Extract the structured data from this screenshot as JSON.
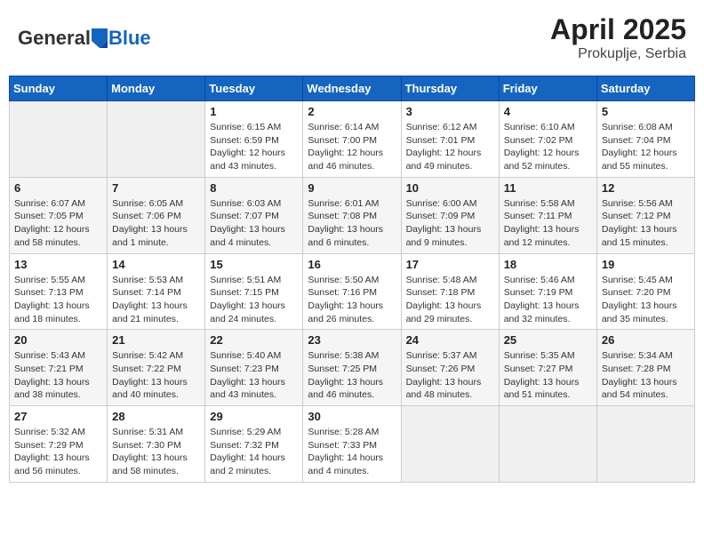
{
  "header": {
    "logo": {
      "general": "General",
      "blue": "Blue",
      "tagline": ""
    },
    "title": "April 2025",
    "subtitle": "Prokuplje, Serbia"
  },
  "weekdays": [
    "Sunday",
    "Monday",
    "Tuesday",
    "Wednesday",
    "Thursday",
    "Friday",
    "Saturday"
  ],
  "weeks": [
    [
      {
        "date": "",
        "empty": true
      },
      {
        "date": "",
        "empty": true
      },
      {
        "date": "1",
        "sunrise": "Sunrise: 6:15 AM",
        "sunset": "Sunset: 6:59 PM",
        "daylight": "Daylight: 12 hours and 43 minutes."
      },
      {
        "date": "2",
        "sunrise": "Sunrise: 6:14 AM",
        "sunset": "Sunset: 7:00 PM",
        "daylight": "Daylight: 12 hours and 46 minutes."
      },
      {
        "date": "3",
        "sunrise": "Sunrise: 6:12 AM",
        "sunset": "Sunset: 7:01 PM",
        "daylight": "Daylight: 12 hours and 49 minutes."
      },
      {
        "date": "4",
        "sunrise": "Sunrise: 6:10 AM",
        "sunset": "Sunset: 7:02 PM",
        "daylight": "Daylight: 12 hours and 52 minutes."
      },
      {
        "date": "5",
        "sunrise": "Sunrise: 6:08 AM",
        "sunset": "Sunset: 7:04 PM",
        "daylight": "Daylight: 12 hours and 55 minutes."
      }
    ],
    [
      {
        "date": "6",
        "sunrise": "Sunrise: 6:07 AM",
        "sunset": "Sunset: 7:05 PM",
        "daylight": "Daylight: 12 hours and 58 minutes."
      },
      {
        "date": "7",
        "sunrise": "Sunrise: 6:05 AM",
        "sunset": "Sunset: 7:06 PM",
        "daylight": "Daylight: 13 hours and 1 minute."
      },
      {
        "date": "8",
        "sunrise": "Sunrise: 6:03 AM",
        "sunset": "Sunset: 7:07 PM",
        "daylight": "Daylight: 13 hours and 4 minutes."
      },
      {
        "date": "9",
        "sunrise": "Sunrise: 6:01 AM",
        "sunset": "Sunset: 7:08 PM",
        "daylight": "Daylight: 13 hours and 6 minutes."
      },
      {
        "date": "10",
        "sunrise": "Sunrise: 6:00 AM",
        "sunset": "Sunset: 7:09 PM",
        "daylight": "Daylight: 13 hours and 9 minutes."
      },
      {
        "date": "11",
        "sunrise": "Sunrise: 5:58 AM",
        "sunset": "Sunset: 7:11 PM",
        "daylight": "Daylight: 13 hours and 12 minutes."
      },
      {
        "date": "12",
        "sunrise": "Sunrise: 5:56 AM",
        "sunset": "Sunset: 7:12 PM",
        "daylight": "Daylight: 13 hours and 15 minutes."
      }
    ],
    [
      {
        "date": "13",
        "sunrise": "Sunrise: 5:55 AM",
        "sunset": "Sunset: 7:13 PM",
        "daylight": "Daylight: 13 hours and 18 minutes."
      },
      {
        "date": "14",
        "sunrise": "Sunrise: 5:53 AM",
        "sunset": "Sunset: 7:14 PM",
        "daylight": "Daylight: 13 hours and 21 minutes."
      },
      {
        "date": "15",
        "sunrise": "Sunrise: 5:51 AM",
        "sunset": "Sunset: 7:15 PM",
        "daylight": "Daylight: 13 hours and 24 minutes."
      },
      {
        "date": "16",
        "sunrise": "Sunrise: 5:50 AM",
        "sunset": "Sunset: 7:16 PM",
        "daylight": "Daylight: 13 hours and 26 minutes."
      },
      {
        "date": "17",
        "sunrise": "Sunrise: 5:48 AM",
        "sunset": "Sunset: 7:18 PM",
        "daylight": "Daylight: 13 hours and 29 minutes."
      },
      {
        "date": "18",
        "sunrise": "Sunrise: 5:46 AM",
        "sunset": "Sunset: 7:19 PM",
        "daylight": "Daylight: 13 hours and 32 minutes."
      },
      {
        "date": "19",
        "sunrise": "Sunrise: 5:45 AM",
        "sunset": "Sunset: 7:20 PM",
        "daylight": "Daylight: 13 hours and 35 minutes."
      }
    ],
    [
      {
        "date": "20",
        "sunrise": "Sunrise: 5:43 AM",
        "sunset": "Sunset: 7:21 PM",
        "daylight": "Daylight: 13 hours and 38 minutes."
      },
      {
        "date": "21",
        "sunrise": "Sunrise: 5:42 AM",
        "sunset": "Sunset: 7:22 PM",
        "daylight": "Daylight: 13 hours and 40 minutes."
      },
      {
        "date": "22",
        "sunrise": "Sunrise: 5:40 AM",
        "sunset": "Sunset: 7:23 PM",
        "daylight": "Daylight: 13 hours and 43 minutes."
      },
      {
        "date": "23",
        "sunrise": "Sunrise: 5:38 AM",
        "sunset": "Sunset: 7:25 PM",
        "daylight": "Daylight: 13 hours and 46 minutes."
      },
      {
        "date": "24",
        "sunrise": "Sunrise: 5:37 AM",
        "sunset": "Sunset: 7:26 PM",
        "daylight": "Daylight: 13 hours and 48 minutes."
      },
      {
        "date": "25",
        "sunrise": "Sunrise: 5:35 AM",
        "sunset": "Sunset: 7:27 PM",
        "daylight": "Daylight: 13 hours and 51 minutes."
      },
      {
        "date": "26",
        "sunrise": "Sunrise: 5:34 AM",
        "sunset": "Sunset: 7:28 PM",
        "daylight": "Daylight: 13 hours and 54 minutes."
      }
    ],
    [
      {
        "date": "27",
        "sunrise": "Sunrise: 5:32 AM",
        "sunset": "Sunset: 7:29 PM",
        "daylight": "Daylight: 13 hours and 56 minutes."
      },
      {
        "date": "28",
        "sunrise": "Sunrise: 5:31 AM",
        "sunset": "Sunset: 7:30 PM",
        "daylight": "Daylight: 13 hours and 58 minutes."
      },
      {
        "date": "29",
        "sunrise": "Sunrise: 5:29 AM",
        "sunset": "Sunset: 7:32 PM",
        "daylight": "Daylight: 14 hours and 2 minutes."
      },
      {
        "date": "30",
        "sunrise": "Sunrise: 5:28 AM",
        "sunset": "Sunset: 7:33 PM",
        "daylight": "Daylight: 14 hours and 4 minutes."
      },
      {
        "date": "",
        "empty": true
      },
      {
        "date": "",
        "empty": true
      },
      {
        "date": "",
        "empty": true
      }
    ]
  ]
}
